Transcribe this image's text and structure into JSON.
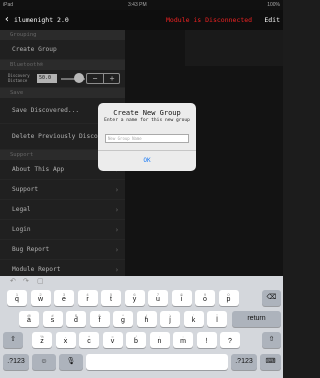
{
  "statusbar": {
    "left": "iPad",
    "time": "3:43 PM",
    "right": "100%"
  },
  "nav": {
    "back_icon": "‹",
    "title": "ilumenight 2.0",
    "status": "Module is Disconnected",
    "status_color": "#e22222",
    "edit": "Edit"
  },
  "sidebar": {
    "grouping_header": "Grouping",
    "create_group": "Create Group",
    "bluetooth_header": "Bluetooth®",
    "discovery_label_1": "Discovery",
    "discovery_label_2": "Distance",
    "discovery_value": "50.0",
    "stepper_minus": "−",
    "stepper_plus": "+",
    "save_header": "Save",
    "save_discovered": "Save Discovered...",
    "delete_previously": "Delete Previously Disco",
    "support_header": "Support",
    "about": "About This App",
    "support": "Support",
    "legal": "Legal",
    "login": "Login",
    "bug_report": "Bug Report",
    "module_report": "Module Report",
    "chevron": "›"
  },
  "dialog": {
    "title": "Create New Group",
    "message": "Enter a name for this new group",
    "placeholder": "New Group Name",
    "ok": "OK",
    "accent": "#1e7cf5"
  },
  "keyboard": {
    "toolbar_icons": [
      "undo-icon",
      "redo-icon",
      "paste-icon"
    ],
    "row1": [
      "q",
      "w",
      "e",
      "r",
      "t",
      "y",
      "u",
      "i",
      "o",
      "p"
    ],
    "row1_sub": [
      "1",
      "2",
      "3",
      "4",
      "5",
      "6",
      "7",
      "8",
      "9",
      "0"
    ],
    "row2": [
      "a",
      "s",
      "d",
      "f",
      "g",
      "h",
      "j",
      "k",
      "l"
    ],
    "row2_sub": [
      "@",
      "#",
      "$",
      "&",
      "*",
      "(",
      ")",
      "'",
      "\""
    ],
    "row3": [
      "z",
      "x",
      "c",
      "v",
      "b",
      "n",
      "m",
      "!",
      "?"
    ],
    "row3_sub": [
      "%",
      "-",
      "+",
      "=",
      "/",
      ";",
      ":",
      ",",
      "."
    ],
    "return": "return",
    "numbers": ".?123",
    "backspace_icon": "⌫",
    "shift_icon": "⇧",
    "emoji_icon": "☺",
    "mic_icon": "🎙",
    "hide_icon": "⌨"
  }
}
